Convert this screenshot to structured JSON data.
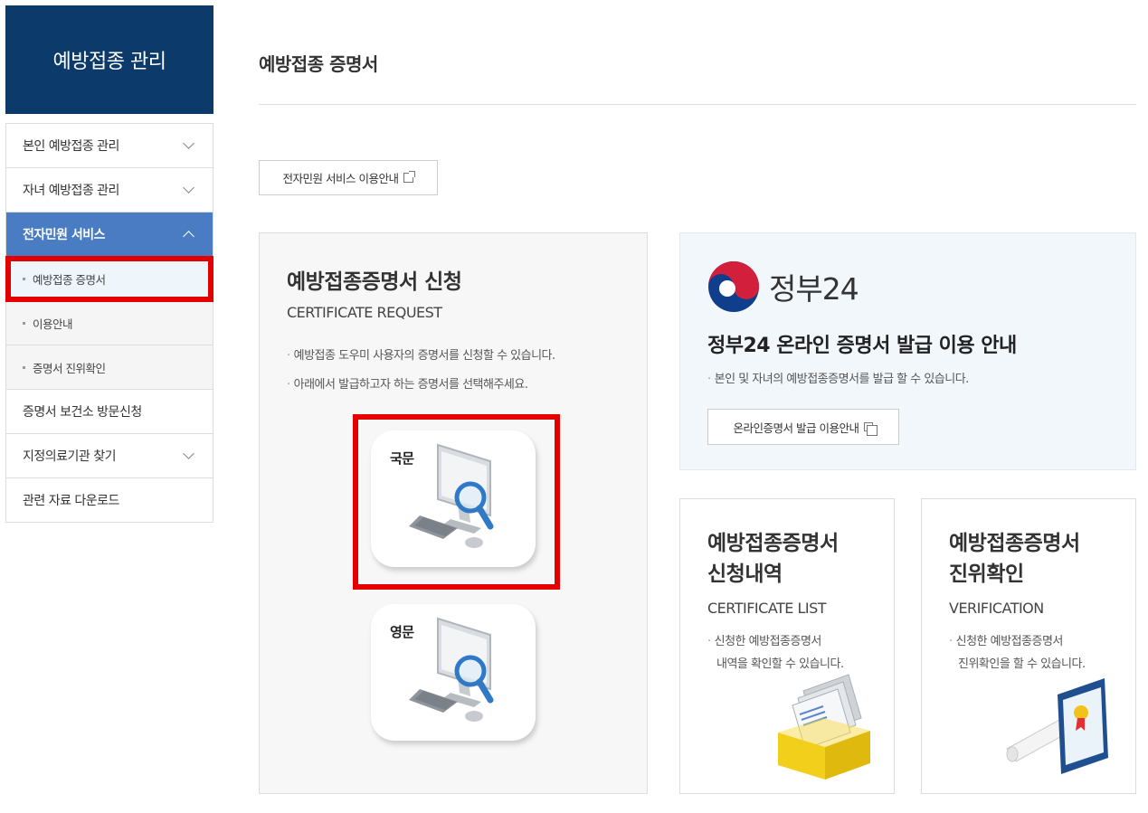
{
  "sidebar": {
    "title": "예방접종 관리",
    "items": [
      {
        "label": "본인 예방접종 관리"
      },
      {
        "label": "자녀 예방접종 관리"
      },
      {
        "label": "전자민원 서비스"
      },
      {
        "label": "증명서 보건소 방문신청"
      },
      {
        "label": "지정의료기관 찾기"
      },
      {
        "label": "관련 자료 다운로드"
      }
    ],
    "sub_items": [
      {
        "label": "예방접종 증명서"
      },
      {
        "label": "이용안내"
      },
      {
        "label": "증명서 진위확인"
      }
    ]
  },
  "page": {
    "title": "예방접종 증명서",
    "guide_button": "전자민원 서비스 이용안내"
  },
  "request_card": {
    "title": "예방접종증명서 신청",
    "subtitle": "CERTIFICATE REQUEST",
    "desc1": "예방접종 도우미 사용자의 증명서를 신청할 수 있습니다.",
    "desc2": "아래에서 발급하고자 하는 증명서를 선택해주세요.",
    "korean_label": "국문",
    "english_label": "영문"
  },
  "gov_card": {
    "logo_text": "정부24",
    "title": "정부24 온라인 증명서 발급 이용 안내",
    "desc": "본인 및 자녀의 예방접종증명서를 발급 할 수 있습니다.",
    "button": "온라인증명서 발급 이용안내"
  },
  "list_card": {
    "title_line1": "예방접종증명서",
    "title_line2": "신청내역",
    "subtitle": "CERTIFICATE LIST",
    "desc_line1": "신청한 예방접종증명서",
    "desc_line2": "내역을 확인할 수 있습니다."
  },
  "verify_card": {
    "title_line1": "예방접종증명서",
    "title_line2": "진위확인",
    "subtitle": "VERIFICATION",
    "desc_line1": "신청한 예방접종증명서",
    "desc_line2": "진위확인을 할 수 있습니다."
  },
  "colors": {
    "sidebar_header": "#0b3a6b",
    "active_menu": "#4a7cc4",
    "highlight": "#e50000"
  }
}
